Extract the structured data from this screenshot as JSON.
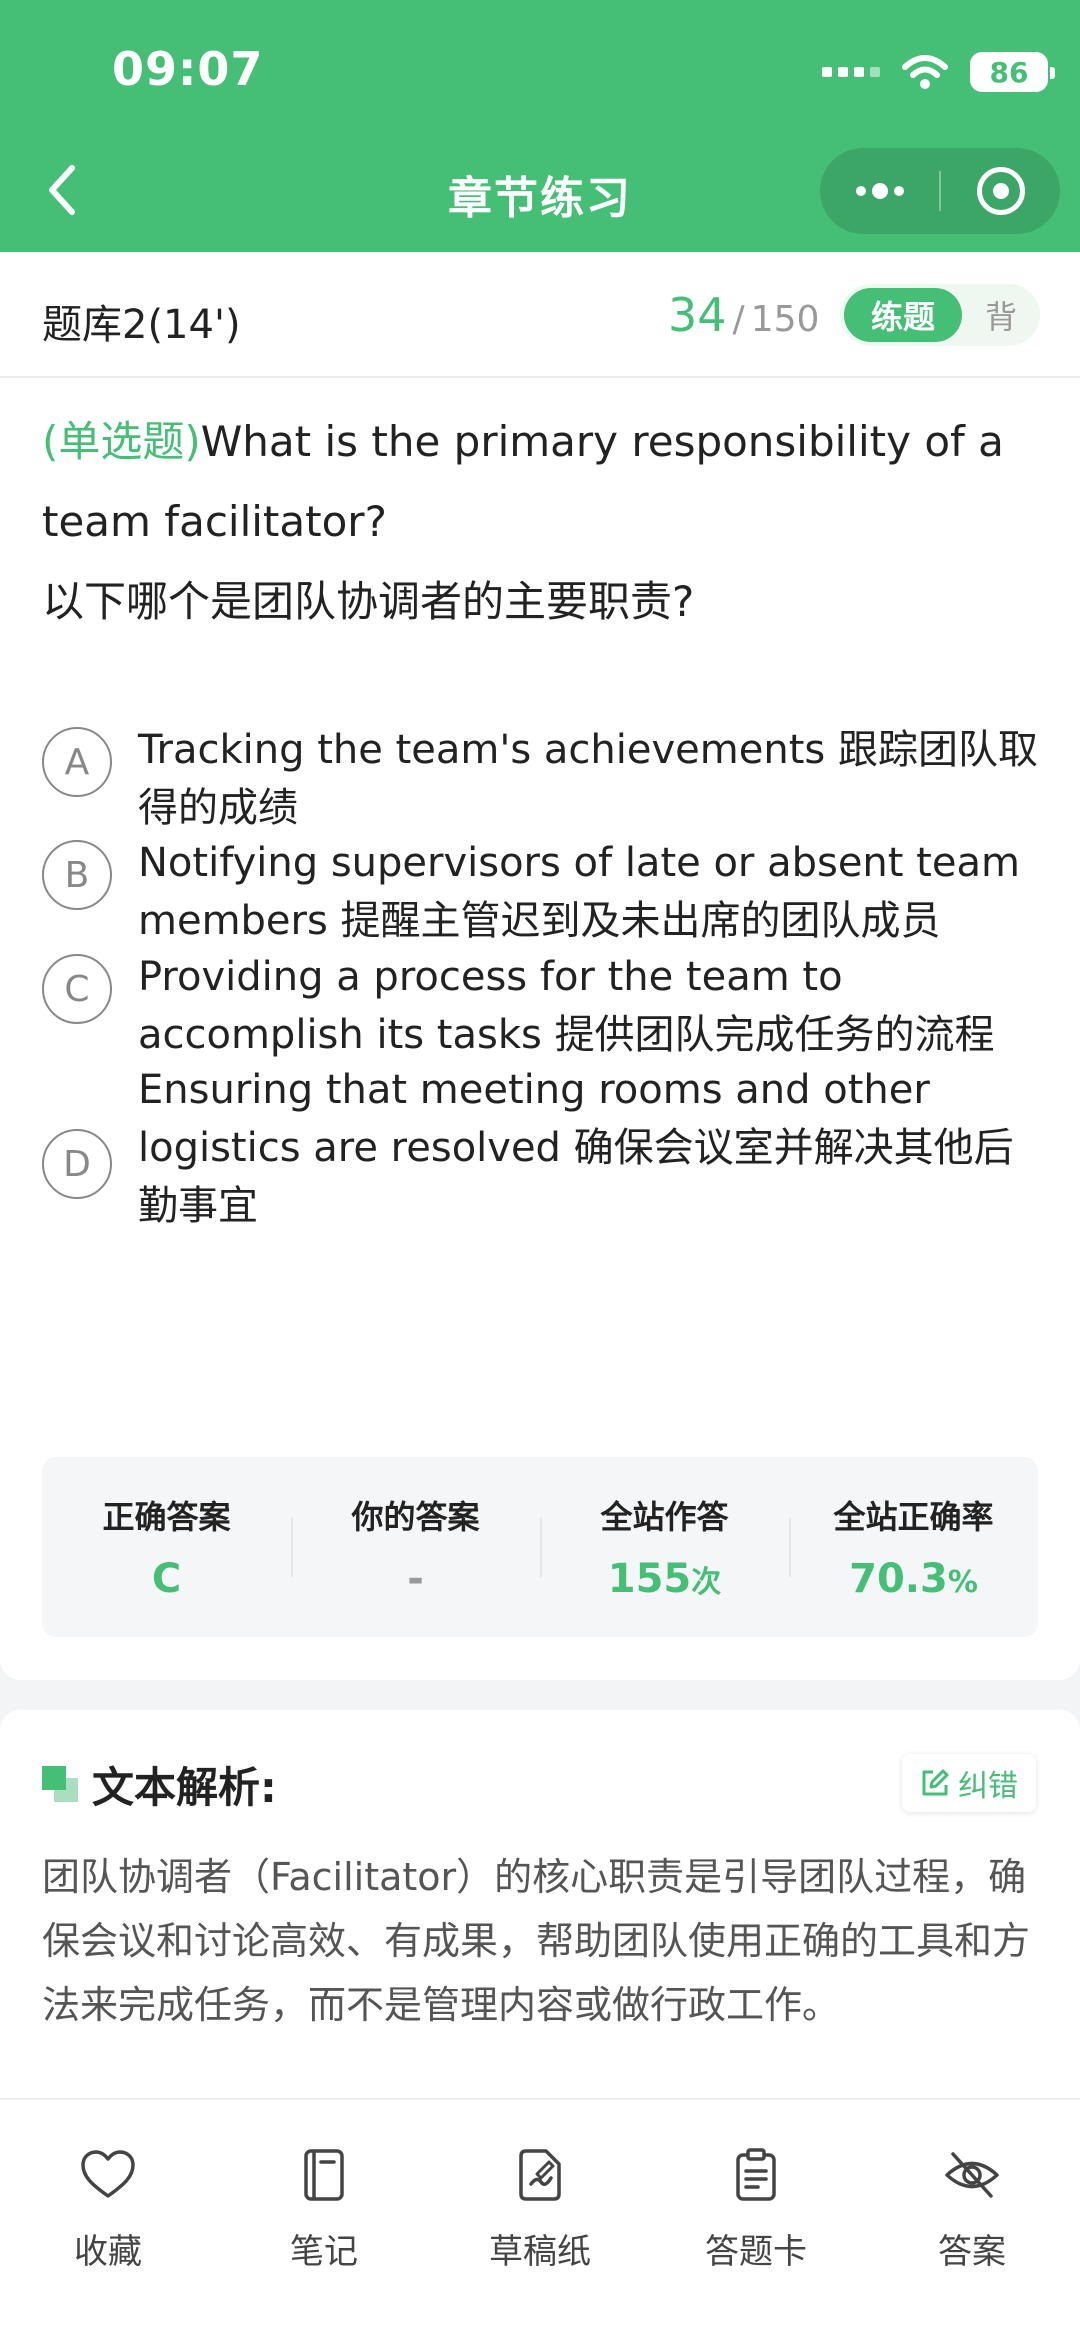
{
  "status_bar": {
    "time": "09:07",
    "battery": "86"
  },
  "header": {
    "title": "章节练习"
  },
  "subbar": {
    "bank_name": "题库2(14')",
    "current": "34",
    "separator": "/",
    "total": "150",
    "mode_active": "练题",
    "mode_inactive": "背"
  },
  "question": {
    "type": "(单选题)",
    "text_en": "What is the primary responsibility of a team facilitator?",
    "text_zh": "以下哪个是团队协调者的主要职责?"
  },
  "options": [
    {
      "letter": "A",
      "text": "Tracking the team's achievements 跟踪团队取得的成绩"
    },
    {
      "letter": "B",
      "text": "Notifying supervisors of late or absent team members 提醒主管迟到及未出席的团队成员"
    },
    {
      "letter": "C",
      "text": "Providing a process for the team to accomplish its tasks 提供团队完成任务的流程"
    },
    {
      "letter": "D",
      "text": "Ensuring that meeting rooms and other logistics are resolved 确保会议室并解决其他后勤事宜"
    }
  ],
  "stats": {
    "correct_label": "正确答案",
    "correct_value": "C",
    "yours_label": "你的答案",
    "yours_value": "-",
    "attempts_label": "全站作答",
    "attempts_value": "155",
    "attempts_unit": "次",
    "rate_label": "全站正确率",
    "rate_value": "70.3",
    "rate_unit": "%"
  },
  "analysis": {
    "title": "文本解析:",
    "report_label": "纠错",
    "text": "团队协调者（Facilitator）的核心职责是引导团队过程，确保会议和讨论高效、有成果，帮助团队使用正确的工具和方法来完成任务，而不是管理内容或做行政工作。"
  },
  "bottom_bar": {
    "favorite": "收藏",
    "notes": "笔记",
    "scratch": "草稿纸",
    "answer_card": "答题卡",
    "answer": "答案"
  },
  "colors": {
    "accent": "#45be76"
  }
}
